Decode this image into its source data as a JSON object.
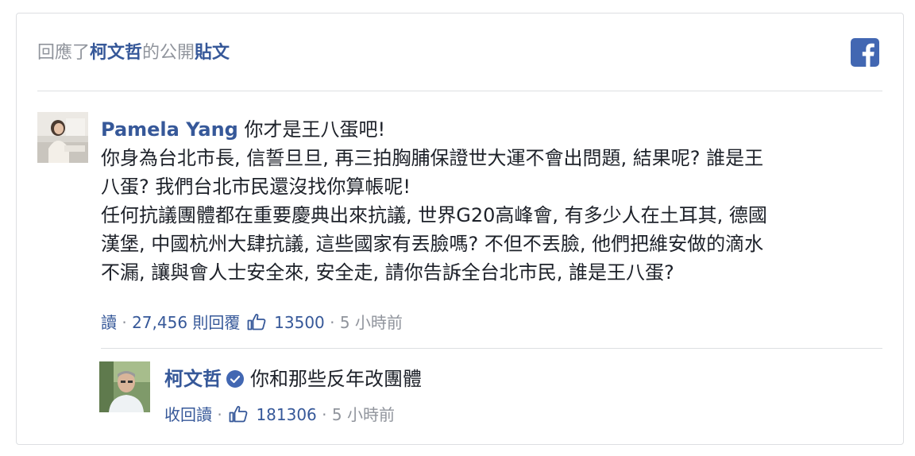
{
  "header": {
    "prefix": "回應了",
    "page_name": "柯文哲",
    "middle": "的公開",
    "post_link": "貼文"
  },
  "logo_icon": "facebook-logo-icon",
  "comment": {
    "author": "Pamela Yang",
    "lines": [
      "你才是王八蛋吧!",
      "你身為台北市長, 信誓旦旦, 再三拍胸脯保證世大運不會出問題, 結果呢? 誰是王",
      "八蛋? 我們台北市民還沒找你算帳呢!",
      "任何抗議團體都在重要慶典出來抗議, 世界G20高峰會, 有多少人在土耳其, 德國",
      "漢堡, 中國杭州大肆抗議, 這些國家有丟臉嗎? 不但不丟臉, 他們把維安做的滴水",
      "不漏, 讓與會人士安全來, 安全走, 請你告訴全台北市民, 誰是王八蛋?"
    ],
    "meta": {
      "read": "讀",
      "replies": "27,456 則回覆",
      "like_icon": "thumbs-up-icon",
      "likes": "13500",
      "time": "5 小時前",
      "sep": "·"
    }
  },
  "reply": {
    "author": "柯文哲",
    "verified_icon": "verified-badge-icon",
    "text": "你和那些反年改團體",
    "meta": {
      "read": "收回讀",
      "like_icon": "thumbs-up-icon",
      "likes": "181306",
      "time": "5 小時前",
      "sep": "·"
    }
  },
  "colors": {
    "link": "#365899",
    "muted": "#90949c",
    "text": "#1d2129",
    "facebook_blue": "#4267b2",
    "border": "#dddfe2"
  }
}
